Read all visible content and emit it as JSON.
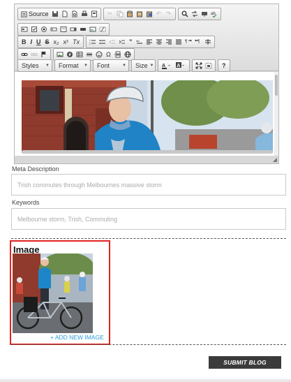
{
  "editor": {
    "toolbar": {
      "source_label": "Source",
      "styles_label": "Styles",
      "format_label": "Format",
      "font_label": "Font",
      "size_label": "Size",
      "bold": "B",
      "italic": "I",
      "underline": "U",
      "strike": "S",
      "subscript": "x₂",
      "superscript": "x²",
      "remove_format": "Tx",
      "help": "?"
    },
    "content_image_alt": "Woman in blue jacket and cycling helmet in front of brick building"
  },
  "meta_description": {
    "label": "Meta Description",
    "placeholder": "Trish commutes through Melbournes massive storm"
  },
  "keywords": {
    "label": "Keywords",
    "placeholder": "Melbourne storm, Trish, Commuting"
  },
  "image_section": {
    "title": "Image",
    "add_new_label": "+ ADD NEW IMAGE"
  },
  "submit_label": "SUBMIT BLOG",
  "colors": {
    "accent_red": "#e0231f",
    "link_blue": "#2aa0d8",
    "submit_bg": "#3b3b3b"
  }
}
